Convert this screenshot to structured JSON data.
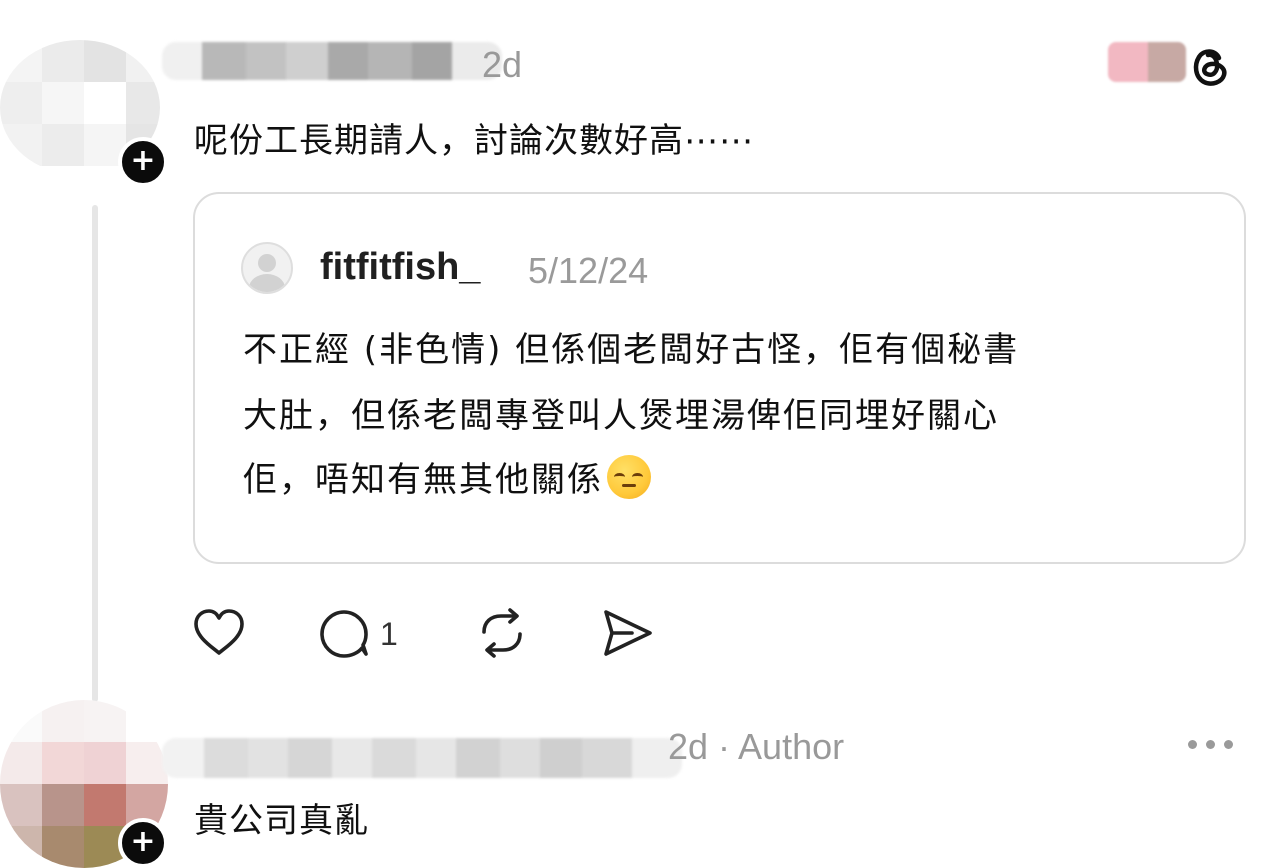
{
  "post": {
    "timestamp": "2d",
    "text": "呢份工長期請人，討論次數好高⋯⋯"
  },
  "quoted": {
    "username": "fitfitfish_",
    "date": "5/12/24",
    "lines": [
      "不正經 (非色情) 但係個老闆好古怪，佢有個秘書",
      "大肚，但係老闆專登叫人煲埋湯俾佢同埋好關心",
      "佢，唔知有無其他關係"
    ]
  },
  "actions": {
    "like_icon": "heart-icon",
    "reply_icon": "comment-icon",
    "reply_count": "1",
    "repost_icon": "repost-icon",
    "share_icon": "send-icon"
  },
  "reply": {
    "timestamp_author": "2d · Author",
    "text": "貴公司真亂"
  },
  "icons": {
    "app": "threads-logo-icon",
    "more": "more-dots-icon",
    "follow": "plus-icon"
  },
  "colors": {
    "text": "#101010",
    "muted": "#999999",
    "border": "#dcdcdc",
    "thread_line": "#e6e6e6"
  }
}
